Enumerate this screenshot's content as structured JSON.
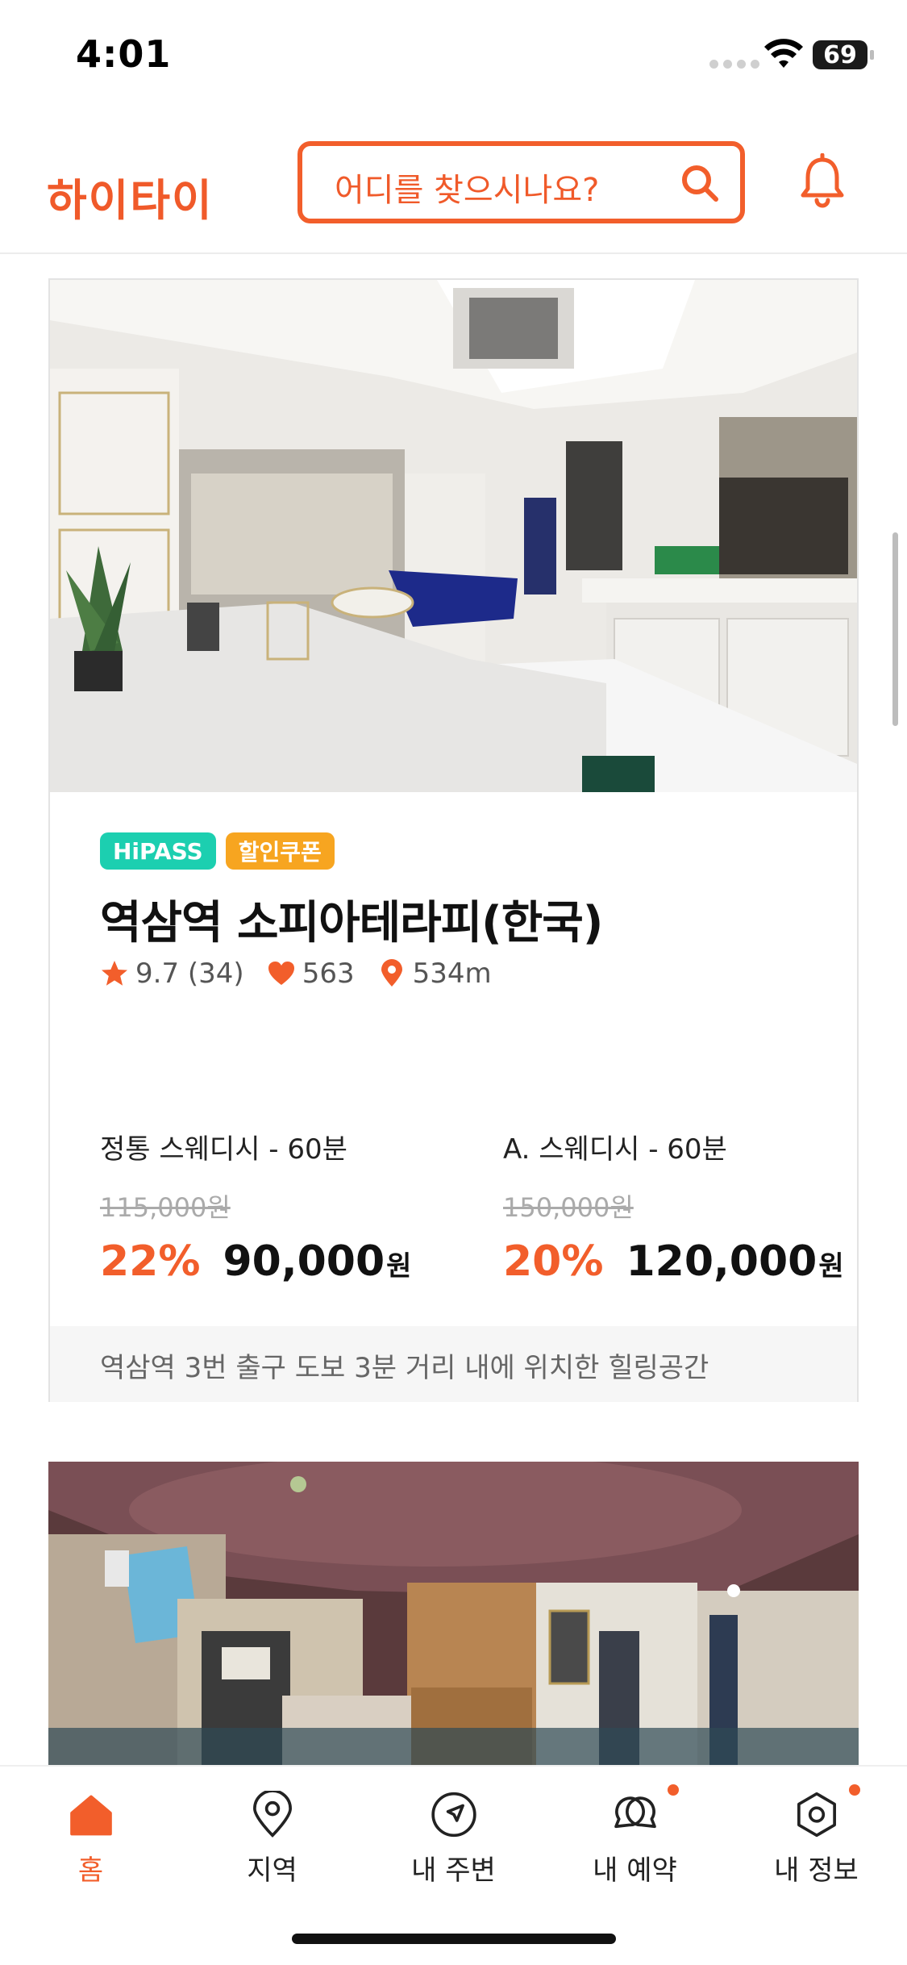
{
  "status_bar": {
    "time": "4:01",
    "battery": "69"
  },
  "header": {
    "logo": "하이타이",
    "search_placeholder": "어디를 찾으시나요?"
  },
  "listing": {
    "badges": [
      "HiPASS",
      "할인쿠폰"
    ],
    "title": "역삼역 소피아테라피(한국)",
    "rating": "9.7",
    "review_count": "(34)",
    "likes": "563",
    "distance": "534m",
    "prices": [
      {
        "name": "정통 스웨디시 - 60분",
        "original": "115,000원",
        "discount": "22%",
        "price": "90,000",
        "unit": "원"
      },
      {
        "name": "A. 스웨디시 - 60분",
        "original": "150,000원",
        "discount": "20%",
        "price": "120,000",
        "unit": "원"
      }
    ],
    "description": "역삼역 3번 출구 도보 3분 거리 내에 위치한 힐링공간"
  },
  "tabbar": {
    "items": [
      {
        "label": "홈",
        "icon": "home-icon",
        "active": true
      },
      {
        "label": "지역",
        "icon": "map-pin-icon"
      },
      {
        "label": "내 주변",
        "icon": "navigation-icon"
      },
      {
        "label": "내 예약",
        "icon": "chat-bubbles-icon"
      },
      {
        "label": "내 정보",
        "icon": "profile-hexagon-icon"
      }
    ]
  },
  "colors": {
    "accent": "#f25e2b",
    "hipass": "#1ccfb0",
    "coupon": "#f7a520"
  }
}
